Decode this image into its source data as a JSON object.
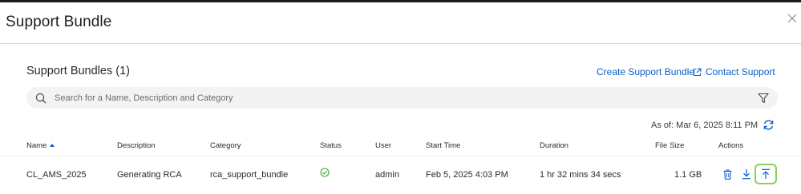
{
  "dialog": {
    "title": "Support Bundle"
  },
  "section": {
    "title": "Support Bundles (1)"
  },
  "links": {
    "create_label": "Create Support Bundle",
    "contact_label": "Contact Support"
  },
  "search": {
    "placeholder": "Search for a Name, Description and Category",
    "value": ""
  },
  "as_of": "As of: Mar 6, 2025 8:11 PM",
  "table": {
    "columns": {
      "name": "Name",
      "description": "Description",
      "category": "Category",
      "status": "Status",
      "user": "User",
      "start_time": "Start Time",
      "duration": "Duration",
      "file_size": "File Size",
      "actions": "Actions"
    },
    "sort": {
      "column": "name",
      "direction": "ascending"
    },
    "rows": [
      {
        "name": "CL_AMS_2025",
        "description": "Generating RCA",
        "category": "rca_support_bundle",
        "status_icon": "check-circle-icon",
        "user": "admin",
        "start_time": "Feb 5, 2025 4:03 PM",
        "duration": "1 hr 32 mins 34 secs",
        "file_size": "1.1 GB",
        "actions": [
          "trash-icon",
          "download-icon",
          "upload-icon"
        ]
      }
    ]
  },
  "icons": {
    "close": "close-icon",
    "external": "external-link-icon",
    "search": "search-icon",
    "filter": "filter-icon",
    "refresh": "refresh-icon"
  },
  "colors": {
    "accent": "#0a60c6",
    "status_ok": "#3aa835",
    "highlight": "#8dcf5a",
    "search_bg": "#f2f3f4"
  }
}
